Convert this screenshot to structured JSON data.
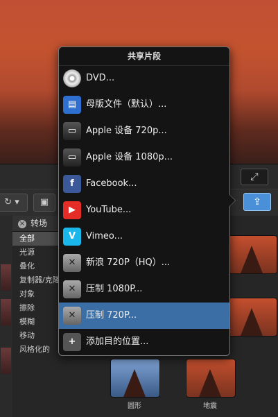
{
  "popover": {
    "title": "共享片段",
    "items": [
      {
        "label": "DVD...",
        "icon": "dvd-icon",
        "glyph": ""
      },
      {
        "label": "母版文件（默认）...",
        "icon": "master-file-icon",
        "glyph": "▤"
      },
      {
        "label": "Apple 设备 720p...",
        "icon": "apple-device-icon",
        "glyph": "▭"
      },
      {
        "label": "Apple 设备 1080p...",
        "icon": "apple-device-icon",
        "glyph": "▭"
      },
      {
        "label": "Facebook...",
        "icon": "facebook-icon",
        "glyph": "f"
      },
      {
        "label": "YouTube...",
        "icon": "youtube-icon",
        "glyph": "▶"
      },
      {
        "label": "Vimeo...",
        "icon": "vimeo-icon",
        "glyph": "V"
      },
      {
        "label": "新浪 720P（HQ）...",
        "icon": "compressor-icon",
        "glyph": "✕"
      },
      {
        "label": "压制 1080P...",
        "icon": "compressor-icon",
        "glyph": "✕"
      },
      {
        "label": "压制 720P...",
        "icon": "compressor-icon",
        "glyph": "✕"
      },
      {
        "label": "添加目的位置...",
        "icon": "add-destination-icon",
        "glyph": "+"
      }
    ],
    "selected_index": 9
  },
  "browser": {
    "header": "转场",
    "categories": [
      "全部",
      "光源",
      "叠化",
      "复制器/克隆",
      "对象",
      "擦除",
      "模糊",
      "移动",
      "风格化的"
    ],
    "selected": "全部"
  },
  "thumbs": {
    "captions": [
      "圆形",
      "地震"
    ]
  },
  "colors": {
    "accent": "#3a6ea5",
    "share": "#4a90d9"
  }
}
